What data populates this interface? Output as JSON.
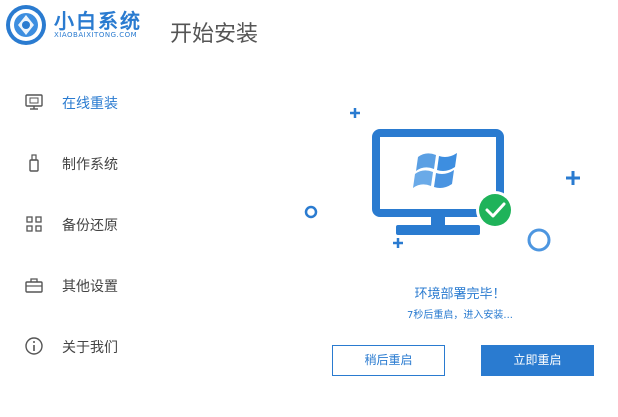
{
  "app": {
    "brand_name": "小白系统",
    "brand_url": "XIAOBAIXITONG.COM",
    "page_title": "开始安装"
  },
  "sidebar": {
    "items": [
      {
        "label": "在线重装",
        "icon": "monitor-icon",
        "active": true
      },
      {
        "label": "制作系统",
        "icon": "usb-drive-icon",
        "active": false
      },
      {
        "label": "备份还原",
        "icon": "grid-icon",
        "active": false
      },
      {
        "label": "其他设置",
        "icon": "toolbox-icon",
        "active": false
      },
      {
        "label": "关于我们",
        "icon": "info-icon",
        "active": false
      }
    ]
  },
  "main": {
    "status_title": "环境部署完毕！",
    "status_subtitle": "7秒后重启，进入安装...",
    "buttons": {
      "later": "稍后重启",
      "now": "立即重启"
    }
  },
  "colors": {
    "accent": "#2a7bd0",
    "success": "#1fb35a"
  }
}
